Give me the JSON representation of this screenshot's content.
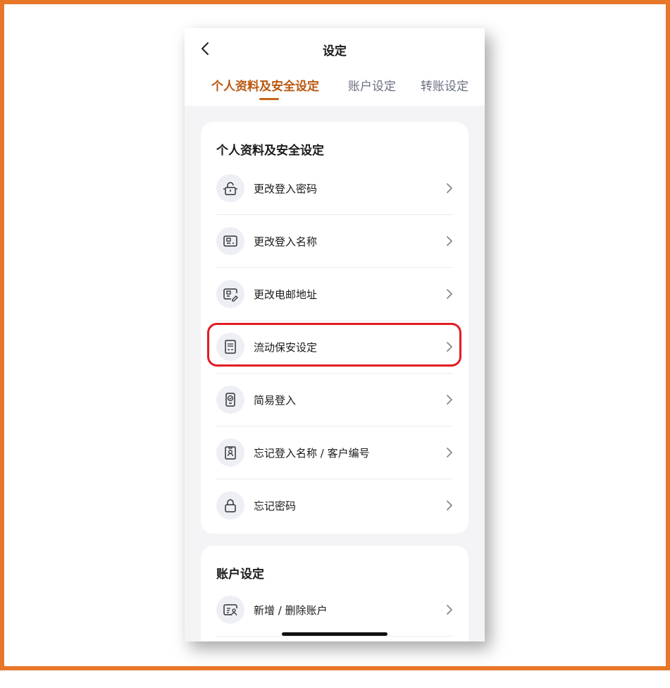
{
  "header": {
    "title": "设定"
  },
  "tabs": [
    {
      "label": "个人资料及安全设定",
      "active": true
    },
    {
      "label": "账户设定",
      "active": false
    },
    {
      "label": "转账设定",
      "active": false
    }
  ],
  "sections": [
    {
      "title": "个人资料及安全设定",
      "items": [
        {
          "label": "更改登入密码",
          "icon": "unlock-icon"
        },
        {
          "label": "更改登入名称",
          "icon": "id-card-icon"
        },
        {
          "label": "更改电邮地址",
          "icon": "edit-card-icon"
        },
        {
          "label": "流动保安设定",
          "icon": "mobile-security-icon"
        },
        {
          "label": "简易登入",
          "icon": "phone-check-icon"
        },
        {
          "label": "忘记登入名称 / 客户编号",
          "icon": "badge-icon"
        },
        {
          "label": "忘记密码",
          "icon": "lock-icon"
        }
      ]
    },
    {
      "title": "账户设定",
      "items": [
        {
          "label": "新增 / 删除账户",
          "icon": "account-card-icon"
        }
      ]
    }
  ],
  "colors": {
    "accent": "#b9570f",
    "highlight": "#e31b23",
    "frame": "#e8772a"
  }
}
